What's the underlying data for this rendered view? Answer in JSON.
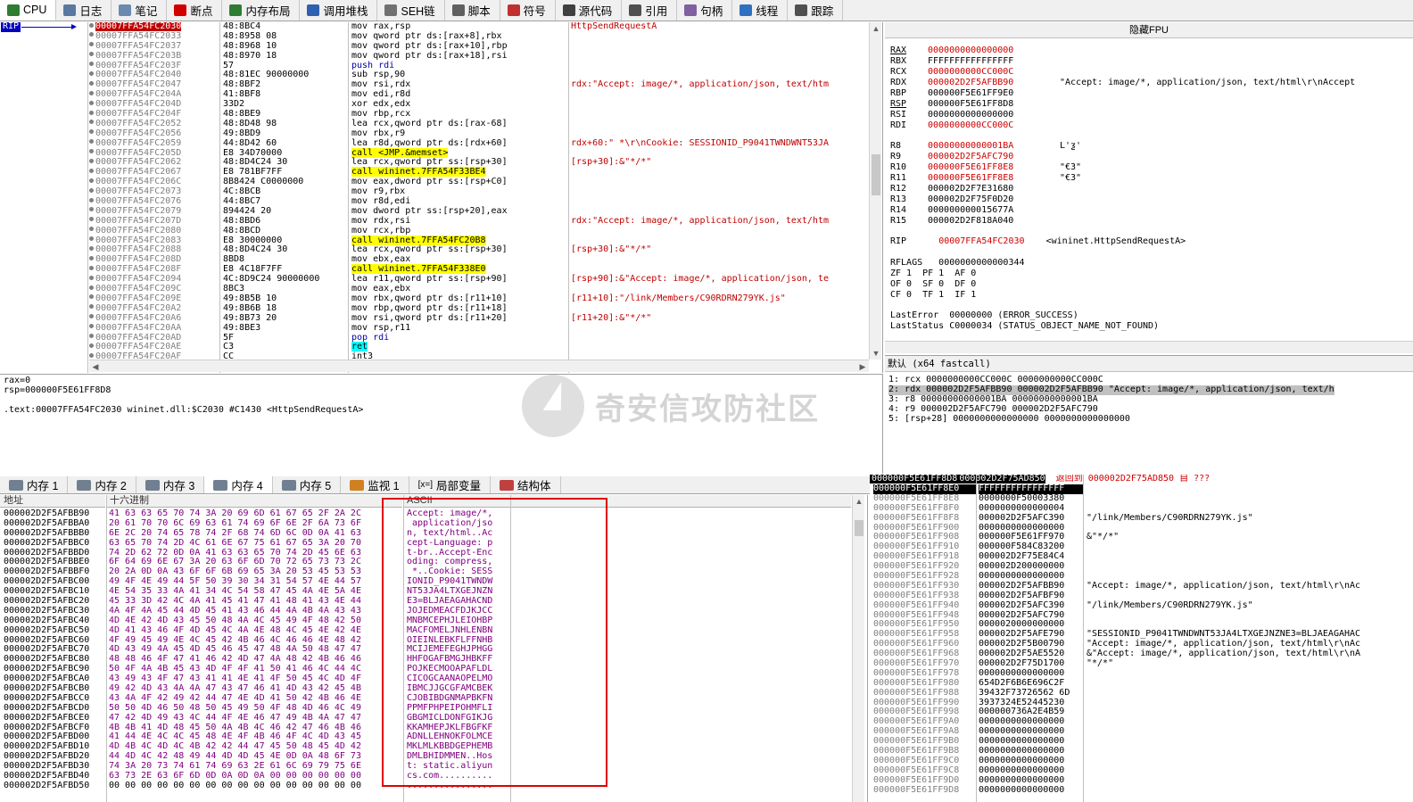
{
  "tabs": [
    {
      "label": "CPU",
      "icon": "cpu-icon",
      "color": "#2e7d32",
      "active": true
    },
    {
      "label": "日志",
      "icon": "log-icon",
      "color": "#5a78a0"
    },
    {
      "label": "笔记",
      "icon": "notes-icon",
      "color": "#6a8ab0"
    },
    {
      "label": "断点",
      "icon": "breakpoint-icon",
      "color": "#d00000"
    },
    {
      "label": "内存布局",
      "icon": "memory-map-icon",
      "color": "#2e7d32"
    },
    {
      "label": "调用堆栈",
      "icon": "call-stack-icon",
      "color": "#3060b0"
    },
    {
      "label": "SEH链",
      "icon": "seh-icon",
      "color": "#707070"
    },
    {
      "label": "脚本",
      "icon": "script-icon",
      "color": "#606060"
    },
    {
      "label": "符号",
      "icon": "symbols-icon",
      "color": "#c03030"
    },
    {
      "label": "源代码",
      "icon": "source-icon",
      "color": "#404040"
    },
    {
      "label": "引用",
      "icon": "references-icon",
      "color": "#505050"
    },
    {
      "label": "句柄",
      "icon": "handles-icon",
      "color": "#8060a0"
    },
    {
      "label": "线程",
      "icon": "threads-icon",
      "color": "#3070c0"
    },
    {
      "label": "跟踪",
      "icon": "trace-icon",
      "color": "#505050"
    }
  ],
  "disasm": {
    "rip_label": "RIP",
    "rows": [
      {
        "addr": "00007FFA54FC2030",
        "bytes": "48:8BC4",
        "ins": "mov rax,rsp",
        "cmt": "HttpSendRequestA",
        "sel": true,
        "kind": "plain"
      },
      {
        "addr": "00007FFA54FC2033",
        "bytes": "48:8958 08",
        "ins": "mov qword ptr ds:[rax+8],rbx",
        "cmt": "",
        "kind": "plain"
      },
      {
        "addr": "00007FFA54FC2037",
        "bytes": "48:8968 10",
        "ins": "mov qword ptr ds:[rax+10],rbp",
        "cmt": "",
        "kind": "plain"
      },
      {
        "addr": "00007FFA54FC203B",
        "bytes": "48:8970 18",
        "ins": "mov qword ptr ds:[rax+18],rsi",
        "cmt": "",
        "kind": "plain"
      },
      {
        "addr": "00007FFA54FC203F",
        "bytes": "57",
        "ins": "push rdi",
        "cmt": "",
        "kind": "push"
      },
      {
        "addr": "00007FFA54FC2040",
        "bytes": "48:81EC 90000000",
        "ins": "sub rsp,90",
        "cmt": "",
        "kind": "plain"
      },
      {
        "addr": "00007FFA54FC2047",
        "bytes": "48:8BF2",
        "ins": "mov rsi,rdx",
        "cmt": "rdx:\"Accept: image/*, application/json, text/htm",
        "kind": "plain"
      },
      {
        "addr": "00007FFA54FC204A",
        "bytes": "41:8BF8",
        "ins": "mov edi,r8d",
        "cmt": "",
        "kind": "plain"
      },
      {
        "addr": "00007FFA54FC204D",
        "bytes": "33D2",
        "ins": "xor edx,edx",
        "cmt": "",
        "kind": "plain"
      },
      {
        "addr": "00007FFA54FC204F",
        "bytes": "48:8BE9",
        "ins": "mov rbp,rcx",
        "cmt": "",
        "kind": "plain"
      },
      {
        "addr": "00007FFA54FC2052",
        "bytes": "48:8D48 98",
        "ins": "lea rcx,qword ptr ds:[rax-68]",
        "cmt": "",
        "kind": "plain"
      },
      {
        "addr": "00007FFA54FC2056",
        "bytes": "49:8BD9",
        "ins": "mov rbx,r9",
        "cmt": "",
        "kind": "plain"
      },
      {
        "addr": "00007FFA54FC2059",
        "bytes": "44:8D42 60",
        "ins": "lea r8d,qword ptr ds:[rdx+60]",
        "cmt": "rdx+60:\" *\\r\\nCookie: SESSIONID_P9041TWNDWNT53JA",
        "kind": "plain"
      },
      {
        "addr": "00007FFA54FC205D",
        "bytes": "E8 34D70000",
        "ins": "call <JMP.&memset>",
        "cmt": "",
        "kind": "call"
      },
      {
        "addr": "00007FFA54FC2062",
        "bytes": "48:8D4C24 30",
        "ins": "lea rcx,qword ptr ss:[rsp+30]",
        "cmt": "[rsp+30]:&\"*/*\"",
        "kind": "plain"
      },
      {
        "addr": "00007FFA54FC2067",
        "bytes": "E8 781BF7FF",
        "ins": "call wininet.7FFA54F33BE4",
        "cmt": "",
        "kind": "call"
      },
      {
        "addr": "00007FFA54FC206C",
        "bytes": "8B8424 C0000000",
        "ins": "mov eax,dword ptr ss:[rsp+C0]",
        "cmt": "",
        "kind": "plain"
      },
      {
        "addr": "00007FFA54FC2073",
        "bytes": "4C:8BCB",
        "ins": "mov r9,rbx",
        "cmt": "",
        "kind": "plain"
      },
      {
        "addr": "00007FFA54FC2076",
        "bytes": "44:8BC7",
        "ins": "mov r8d,edi",
        "cmt": "",
        "kind": "plain"
      },
      {
        "addr": "00007FFA54FC2079",
        "bytes": "894424 20",
        "ins": "mov dword ptr ss:[rsp+20],eax",
        "cmt": "",
        "kind": "plain"
      },
      {
        "addr": "00007FFA54FC207D",
        "bytes": "48:8BD6",
        "ins": "mov rdx,rsi",
        "cmt": "rdx:\"Accept: image/*, application/json, text/htm",
        "kind": "plain"
      },
      {
        "addr": "00007FFA54FC2080",
        "bytes": "48:8BCD",
        "ins": "mov rcx,rbp",
        "cmt": "",
        "kind": "plain"
      },
      {
        "addr": "00007FFA54FC2083",
        "bytes": "E8 30000000",
        "ins": "call wininet.7FFA54FC20B8",
        "cmt": "",
        "kind": "call"
      },
      {
        "addr": "00007FFA54FC2088",
        "bytes": "48:8D4C24 30",
        "ins": "lea rcx,qword ptr ss:[rsp+30]",
        "cmt": "[rsp+30]:&\"*/*\"",
        "kind": "plain"
      },
      {
        "addr": "00007FFA54FC208D",
        "bytes": "8BD8",
        "ins": "mov ebx,eax",
        "cmt": "",
        "kind": "plain"
      },
      {
        "addr": "00007FFA54FC208F",
        "bytes": "E8 4C18F7FF",
        "ins": "call wininet.7FFA54F338E0",
        "cmt": "",
        "kind": "call"
      },
      {
        "addr": "00007FFA54FC2094",
        "bytes": "4C:8D9C24 90000000",
        "ins": "lea r11,qword ptr ss:[rsp+90]",
        "cmt": "[rsp+90]:&\"Accept: image/*, application/json, te",
        "kind": "plain"
      },
      {
        "addr": "00007FFA54FC209C",
        "bytes": "8BC3",
        "ins": "mov eax,ebx",
        "cmt": "",
        "kind": "plain"
      },
      {
        "addr": "00007FFA54FC209E",
        "bytes": "49:8B5B 10",
        "ins": "mov rbx,qword ptr ds:[r11+10]",
        "cmt": "[r11+10]:\"/link/Members/C90RDRN279YK.js\"",
        "kind": "plain"
      },
      {
        "addr": "00007FFA54FC20A2",
        "bytes": "49:8B6B 18",
        "ins": "mov rbp,qword ptr ds:[r11+18]",
        "cmt": "",
        "kind": "plain"
      },
      {
        "addr": "00007FFA54FC20A6",
        "bytes": "49:8B73 20",
        "ins": "mov rsi,qword ptr ds:[r11+20]",
        "cmt": "[r11+20]:&\"*/*\"",
        "kind": "plain"
      },
      {
        "addr": "00007FFA54FC20AA",
        "bytes": "49:8BE3",
        "ins": "mov rsp,r11",
        "cmt": "",
        "kind": "plain"
      },
      {
        "addr": "00007FFA54FC20AD",
        "bytes": "5F",
        "ins": "pop rdi",
        "cmt": "",
        "kind": "push"
      },
      {
        "addr": "00007FFA54FC20AE",
        "bytes": "C3",
        "ins": "ret",
        "cmt": "",
        "kind": "ret"
      },
      {
        "addr": "00007FFA54FC20AF",
        "bytes": "CC",
        "ins": "int3",
        "cmt": "",
        "kind": "plain"
      }
    ]
  },
  "registers": {
    "title": "隐藏FPU",
    "general": [
      {
        "name": "RAX",
        "value": "0000000000000000",
        "chg": true,
        "extra": ""
      },
      {
        "name": "RBX",
        "value": "FFFFFFFFFFFFFFFF",
        "chg": false,
        "extra": ""
      },
      {
        "name": "RCX",
        "value": "0000000000CC000C",
        "chg": true,
        "extra": ""
      },
      {
        "name": "RDX",
        "value": "000002D2F5AFBB90",
        "chg": true,
        "extra": "\"Accept: image/*, application/json, text/html\\r\\nAccept"
      },
      {
        "name": "RBP",
        "value": "000000F5E61FF9E0",
        "chg": false,
        "extra": ""
      },
      {
        "name": "RSP",
        "value": "000000F5E61FF8D8",
        "chg": false,
        "extra": ""
      },
      {
        "name": "RSI",
        "value": "0000000000000000",
        "chg": false,
        "extra": ""
      },
      {
        "name": "RDI",
        "value": "0000000000CC000C",
        "chg": true,
        "extra": ""
      }
    ],
    "ext": [
      {
        "name": "R8",
        "value": "00000000000001BA",
        "chg": true,
        "extra": "L'ƺ'"
      },
      {
        "name": "R9",
        "value": "000002D2F5AFC790",
        "chg": true,
        "extra": ""
      },
      {
        "name": "R10",
        "value": "000000F5E61FF8E8",
        "chg": true,
        "extra": "\"€3\""
      },
      {
        "name": "R11",
        "value": "000000F5E61FF8E8",
        "chg": true,
        "extra": "\"€3\""
      },
      {
        "name": "R12",
        "value": "000002D2F7E31680",
        "chg": false,
        "extra": ""
      },
      {
        "name": "R13",
        "value": "000002D2F75F0D20",
        "chg": false,
        "extra": ""
      },
      {
        "name": "R14",
        "value": "000000000015677A",
        "chg": false,
        "extra": ""
      },
      {
        "name": "R15",
        "value": "000002D2F818A040",
        "chg": false,
        "extra": ""
      }
    ],
    "rip": {
      "name": "RIP",
      "value": "00007FFA54FC2030",
      "extra": "<wininet.HttpSendRequestA>"
    },
    "rflags": "RFLAGS   0000000000000344",
    "flags": [
      "ZF 1  PF 1  AF 0",
      "OF 0  SF 0  DF 0",
      "CF 0  TF 1  IF 1"
    ],
    "lasterror": "LastError  00000000 (ERROR_SUCCESS)",
    "laststatus": "LastStatus C0000034 (STATUS_OBJECT_NAME_NOT_FOUND)"
  },
  "callconv": {
    "title": "默认 (x64 fastcall)",
    "args": [
      "1: rcx 0000000000CC000C 0000000000CC000C",
      "2: rdx 000002D2F5AFBB90 000002D2F5AFBB90 \"Accept: image/*, application/json, text/h",
      "3: r8 00000000000001BA 00000000000001BA",
      "4: r9 000002D2F5AFC790 000002D2F5AFC790",
      "5: [rsp+28] 0000000000000000 0000000000000000"
    ]
  },
  "info": {
    "line1": "rax=0",
    "line2": "rsp=000000F5E61FF8D8",
    "line3": ".text:00007FFA54FC2030 wininet.dll:$C2030 #C1430 <HttpSendRequestA>"
  },
  "watermark": "奇安信攻防社区",
  "bottom_tabs": [
    {
      "label": "内存 1",
      "icon": "memory-icon",
      "active": false
    },
    {
      "label": "内存 2",
      "icon": "memory-icon",
      "active": false
    },
    {
      "label": "内存 3",
      "icon": "memory-icon",
      "active": false
    },
    {
      "label": "内存 4",
      "icon": "memory-icon",
      "active": true
    },
    {
      "label": "内存 5",
      "icon": "memory-icon",
      "active": false
    },
    {
      "label": "监视 1",
      "icon": "watch-icon",
      "active": false
    },
    {
      "label": "局部变量",
      "icon": "locals-icon",
      "active": false,
      "prefix": "[x=]"
    },
    {
      "label": "结构体",
      "icon": "struct-icon",
      "active": false
    }
  ],
  "dump": {
    "h_addr": "地址",
    "h_hex": "十六进制",
    "h_ascii": "ASCII",
    "rows": [
      {
        "a": "000002D2F5AFBB90",
        "h": "41 63 63 65 70 74 3A 20 69 6D 61 67 65 2F 2A 2C",
        "t": "Accept: image/*,"
      },
      {
        "a": "000002D2F5AFBBA0",
        "h": "20 61 70 70 6C 69 63 61 74 69 6F 6E 2F 6A 73 6F",
        "t": " application/jso"
      },
      {
        "a": "000002D2F5AFBBB0",
        "h": "6E 2C 20 74 65 78 74 2F 68 74 6D 6C 0D 0A 41 63",
        "t": "n, text/html..Ac"
      },
      {
        "a": "000002D2F5AFBBC0",
        "h": "63 65 70 74 2D 4C 61 6E 67 75 61 67 65 3A 20 70",
        "t": "cept-Language: p"
      },
      {
        "a": "000002D2F5AFBBD0",
        "h": "74 2D 62 72 0D 0A 41 63 63 65 70 74 2D 45 6E 63",
        "t": "t-br..Accept-Enc"
      },
      {
        "a": "000002D2F5AFBBE0",
        "h": "6F 64 69 6E 67 3A 20 63 6F 6D 70 72 65 73 73 2C",
        "t": "oding: compress,"
      },
      {
        "a": "000002D2F5AFBBF0",
        "h": "20 2A 0D 0A 43 6F 6F 6B 69 65 3A 20 53 45 53 53",
        "t": " *..Cookie: SESS"
      },
      {
        "a": "000002D2F5AFBC00",
        "h": "49 4F 4E 49 44 5F 50 39 30 34 31 54 57 4E 44 57",
        "t": "IONID_P9041TWNDW"
      },
      {
        "a": "000002D2F5AFBC10",
        "h": "4E 54 35 33 4A 41 34 4C 54 58 47 45 4A 4E 5A 4E",
        "t": "NT53JA4LTXGEJNZN"
      },
      {
        "a": "000002D2F5AFBC20",
        "h": "45 33 3D 42 4C 4A 41 45 41 47 41 48 41 43 4E 44",
        "t": "E3=BLJAEAGAHACND"
      },
      {
        "a": "000002D2F5AFBC30",
        "h": "4A 4F 4A 45 44 4D 45 41 43 46 44 4A 4B 4A 43 43",
        "t": "JOJEDMEACFDJKJCC"
      },
      {
        "a": "000002D2F5AFBC40",
        "h": "4D 4E 42 4D 43 45 50 48 4A 4C 45 49 4F 48 42 50",
        "t": "MNBMCEPHJLEIOHBP"
      },
      {
        "a": "000002D2F5AFBC50",
        "h": "4D 41 43 46 4F 4D 45 4C 4A 4E 48 4C 45 4E 42 4E",
        "t": "MACFOMELJNHLENBN"
      },
      {
        "a": "000002D2F5AFBC60",
        "h": "4F 49 45 49 4E 4C 45 42 4B 46 4C 46 46 4E 48 42",
        "t": "OIEINLEBKFLFFNHB"
      },
      {
        "a": "000002D2F5AFBC70",
        "h": "4D 43 49 4A 45 4D 45 46 45 47 48 4A 50 48 47 47",
        "t": "MCIJEMEFEGHJPHGG"
      },
      {
        "a": "000002D2F5AFBC80",
        "h": "48 48 46 4F 47 41 46 42 4D 47 4A 48 42 4B 46 46",
        "t": "HHFOGAFBMGJHBKFF"
      },
      {
        "a": "000002D2F5AFBC90",
        "h": "50 4F 4A 4B 45 43 4D 4F 4F 41 50 41 46 4C 44 4C",
        "t": "POJKECMOOAPAFLDL"
      },
      {
        "a": "000002D2F5AFBCA0",
        "h": "43 49 43 4F 47 43 41 41 4E 41 4F 50 45 4C 4D 4F",
        "t": "CICOGCAANAOPELMO"
      },
      {
        "a": "000002D2F5AFBCB0",
        "h": "49 42 4D 43 4A 4A 47 43 47 46 41 4D 43 42 45 4B",
        "t": "IBMCJJGCGFAMCBEK"
      },
      {
        "a": "000002D2F5AFBCC0",
        "h": "43 4A 4F 42 49 42 44 47 4E 4D 41 50 42 4B 46 4E",
        "t": "CJOBIBDGNMAPBKFN"
      },
      {
        "a": "000002D2F5AFBCD0",
        "h": "50 50 4D 46 50 48 50 45 49 50 4F 48 4D 46 4C 49",
        "t": "PPMFPHPEIPOHMFLI"
      },
      {
        "a": "000002D2F5AFBCE0",
        "h": "47 42 4D 49 43 4C 44 4F 4E 46 47 49 4B 4A 47 47",
        "t": "GBGMICLDONFGIKJG"
      },
      {
        "a": "000002D2F5AFBCF0",
        "h": "4B 4B 41 4D 48 45 50 4A 4B 4C 46 42 47 46 4B 46",
        "t": "KKAMHEPJKLFBGFKF"
      },
      {
        "a": "000002D2F5AFBD00",
        "h": "41 44 4E 4C 4C 45 48 4E 4F 4B 46 4F 4C 4D 43 45",
        "t": "ADNLLEHNOKFOLMCE"
      },
      {
        "a": "000002D2F5AFBD10",
        "h": "4D 4B 4C 4D 4C 4B 42 42 44 47 45 50 48 45 4D 42",
        "t": "MKLMLKBBDGEPHEMB"
      },
      {
        "a": "000002D2F5AFBD20",
        "h": "44 4D 4C 42 48 49 44 4D 4D 45 4E 0D 0A 48 6F 73",
        "t": "DMLBHIDMMEN..Hos"
      },
      {
        "a": "000002D2F5AFBD30",
        "h": "74 3A 20 73 74 61 74 69 63 2E 61 6C 69 79 75 6E",
        "t": "t: static.aliyun"
      },
      {
        "a": "000002D2F5AFBD40",
        "h": "63 73 2E 63 6F 6D 0D 0A 0D 0A 00 00 00 00 00 00",
        "t": "cs.com.........."
      },
      {
        "a": "000002D2F5AFBD50",
        "h": "00 00 00 00 00 00 00 00 00 00 00 00 00 00 00 00",
        "t": "................"
      }
    ]
  },
  "stack": {
    "top_addr": "000000F5E61FF8D8",
    "top_val": "000002D2F75AD850",
    "top_cmt": "返回到 000002D2F75AD850 自 ???",
    "rows": [
      {
        "a": "000000F5E61FF8E0",
        "v": "FFFFFFFFFFFFFFFF",
        "c": ""
      },
      {
        "a": "000000F5E61FF8E8",
        "v": "0000000F50003380",
        "c": ""
      },
      {
        "a": "000000F5E61FF8F0",
        "v": "0000000000000004",
        "c": ""
      },
      {
        "a": "000000F5E61FF8F8",
        "v": "000002D2F5AFC390",
        "c": "\"/link/Members/C90RDRN279YK.js\""
      },
      {
        "a": "000000F5E61FF900",
        "v": "0000000000000000",
        "c": ""
      },
      {
        "a": "000000F5E61FF908",
        "v": "000000F5E61FF970",
        "c": "&\"*/*\""
      },
      {
        "a": "000000F5E61FF910",
        "v": "000000F584C83200",
        "c": ""
      },
      {
        "a": "000000F5E61FF918",
        "v": "000002D2F75E84C4",
        "c": ""
      },
      {
        "a": "000000F5E61FF920",
        "v": "000002D200000000",
        "c": ""
      },
      {
        "a": "000000F5E61FF928",
        "v": "0000000000000000",
        "c": ""
      },
      {
        "a": "000000F5E61FF930",
        "v": "000002D2F5AFBB90",
        "c": "\"Accept: image/*, application/json, text/html\\r\\nAc"
      },
      {
        "a": "000000F5E61FF938",
        "v": "000002D2F5AFBF90",
        "c": ""
      },
      {
        "a": "000000F5E61FF940",
        "v": "000002D2F5AFC390",
        "c": "\"/link/Members/C90RDRN279YK.js\""
      },
      {
        "a": "000000F5E61FF948",
        "v": "000002D2F5AFC790",
        "c": ""
      },
      {
        "a": "000000F5E61FF950",
        "v": "0000020000000000",
        "c": ""
      },
      {
        "a": "000000F5E61FF958",
        "v": "000002D2F5AFE790",
        "c": "\"SESSIONID_P9041TWNDWNT53JA4LTXGEJNZNE3=BLJAEAGAHAC"
      },
      {
        "a": "000000F5E61FF960",
        "v": "000002D2F5B00790",
        "c": "\"Accept: image/*, application/json, text/html\\r\\nAc"
      },
      {
        "a": "000000F5E61FF968",
        "v": "000002D2F5AE5520",
        "c": "&\"Accept: image/*, application/json, text/html\\r\\nA"
      },
      {
        "a": "000000F5E61FF970",
        "v": "000002D2F75D1700",
        "c": "\"*/*\""
      },
      {
        "a": "000000F5E61FF978",
        "v": "0000000000000000",
        "c": ""
      },
      {
        "a": "000000F5E61FF980",
        "v": "654D2F6B6E696C2F",
        "c": ""
      },
      {
        "a": "000000F5E61FF988",
        "v": "39432F73726562 6D",
        "c": ""
      },
      {
        "a": "000000F5E61FF990",
        "v": "3937324E52445230",
        "c": ""
      },
      {
        "a": "000000F5E61FF998",
        "v": "000000736A2E4B59",
        "c": ""
      },
      {
        "a": "000000F5E61FF9A0",
        "v": "0000000000000000",
        "c": ""
      },
      {
        "a": "000000F5E61FF9A8",
        "v": "0000000000000000",
        "c": ""
      },
      {
        "a": "000000F5E61FF9B0",
        "v": "0000000000000000",
        "c": ""
      },
      {
        "a": "000000F5E61FF9B8",
        "v": "0000000000000000",
        "c": ""
      },
      {
        "a": "000000F5E61FF9C0",
        "v": "0000000000000000",
        "c": ""
      },
      {
        "a": "000000F5E61FF9C8",
        "v": "0000000000000000",
        "c": ""
      },
      {
        "a": "000000F5E61FF9D0",
        "v": "0000000000000000",
        "c": ""
      },
      {
        "a": "000000F5E61FF9D8",
        "v": "0000000000000000",
        "c": ""
      }
    ]
  }
}
